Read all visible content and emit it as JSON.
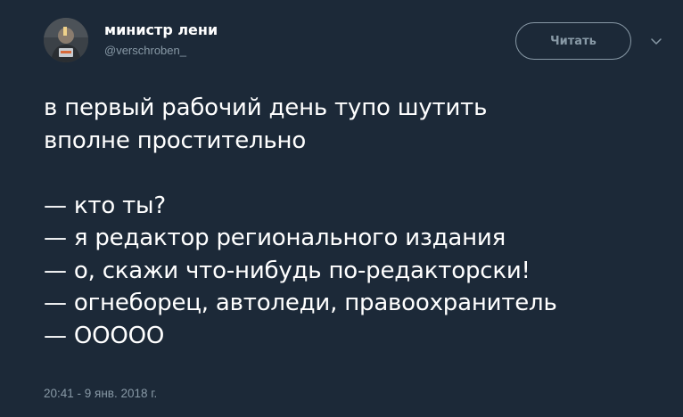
{
  "author": {
    "display_name": "министр лени",
    "handle": "@verschroben_"
  },
  "follow_button": {
    "label": "Читать"
  },
  "tweet": {
    "lines": [
      "в первый рабочий день тупо шутить",
      "вполне простительно",
      "",
      "— кто ты?",
      "— я редактор регионального издания",
      "— о, скажи что-нибудь по-редакторски!",
      "— огнеборец, автоледи, правоохранитель",
      "— ООООО"
    ]
  },
  "timestamp": "20:41 - 9 янв. 2018 г.",
  "colors": {
    "background": "#1c2938",
    "text": "#ffffff",
    "muted": "#8899a6"
  },
  "icons": {
    "menu": "chevron-down-icon",
    "avatar": "avatar-photo"
  }
}
